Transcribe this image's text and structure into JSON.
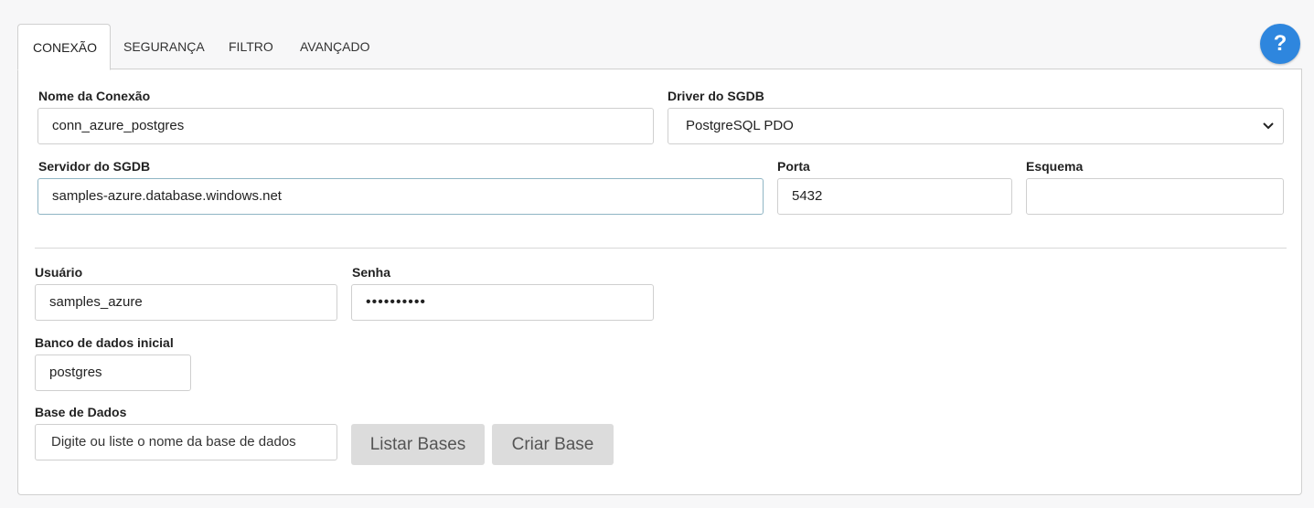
{
  "tabs": [
    {
      "label": "CONEXÃO",
      "active": true
    },
    {
      "label": "SEGURANÇA",
      "active": false
    },
    {
      "label": "FILTRO",
      "active": false
    },
    {
      "label": "AVANÇADO",
      "active": false
    }
  ],
  "help": {
    "label": "?",
    "color": "#2e86de"
  },
  "form": {
    "connection_name": {
      "label": "Nome da Conexão",
      "value": "conn_azure_postgres"
    },
    "driver": {
      "label": "Driver do SGDB",
      "value": "PostgreSQL PDO"
    },
    "server": {
      "label": "Servidor do SGDB",
      "value": "samples-azure.database.windows.net"
    },
    "port": {
      "label": "Porta",
      "value": "5432"
    },
    "schema": {
      "label": "Esquema",
      "value": ""
    },
    "user": {
      "label": "Usuário",
      "value": "samples_azure"
    },
    "password": {
      "label": "Senha",
      "value": "••••••••••"
    },
    "initial_db": {
      "label": "Banco de dados inicial",
      "value": "postgres"
    },
    "database": {
      "label": "Base de Dados",
      "placeholder": "Digite ou liste o nome da base de dados"
    }
  },
  "buttons": {
    "list_label": "Listar Bases",
    "create_label": "Criar Base"
  }
}
